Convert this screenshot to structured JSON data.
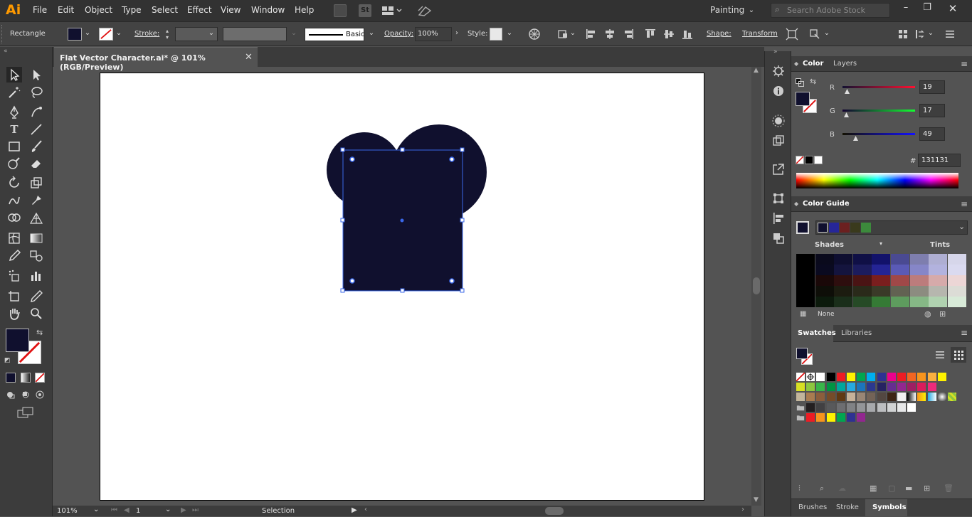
{
  "app": {
    "logo": "Ai"
  },
  "menu": [
    "File",
    "Edit",
    "Object",
    "Type",
    "Select",
    "Effect",
    "View",
    "Window",
    "Help"
  ],
  "workspace": "Painting",
  "search": {
    "placeholder": "Search Adobe Stock"
  },
  "control_bar": {
    "tool_name": "Rectangle",
    "stroke_label": "Stroke:",
    "brush_label": "Basic",
    "opacity_label": "Opacity:",
    "opacity_value": "100%",
    "style_label": "Style:",
    "shape_label": "Shape:",
    "transform_label": "Transform"
  },
  "document": {
    "tab_title": "Flat Vector Character.ai* @ 101% (RGB/Preview)",
    "close": "✕"
  },
  "status": {
    "zoom": "101%",
    "artboard": "1",
    "tool": "Selection"
  },
  "color_panel": {
    "tabs": [
      "Color",
      "Layers"
    ],
    "active_tab": "Color",
    "r_label": "R",
    "g_label": "G",
    "b_label": "B",
    "r": "19",
    "g": "17",
    "b": "49",
    "hex_label": "#",
    "hex": "131131"
  },
  "color_guide": {
    "title": "Color Guide",
    "shades": "Shades",
    "tints": "Tints",
    "none_label": "None"
  },
  "swatches_panel": {
    "tabs": [
      "Swatches",
      "Libraries"
    ],
    "active_tab": "Swatches"
  },
  "bottom_tabs": [
    "Brushes",
    "Stroke",
    "Symbols"
  ],
  "active_bottom_tab": "Symbols",
  "colors": {
    "fill": "#10102e",
    "accent": "#ff9a00",
    "selection": "#3a67e8"
  }
}
